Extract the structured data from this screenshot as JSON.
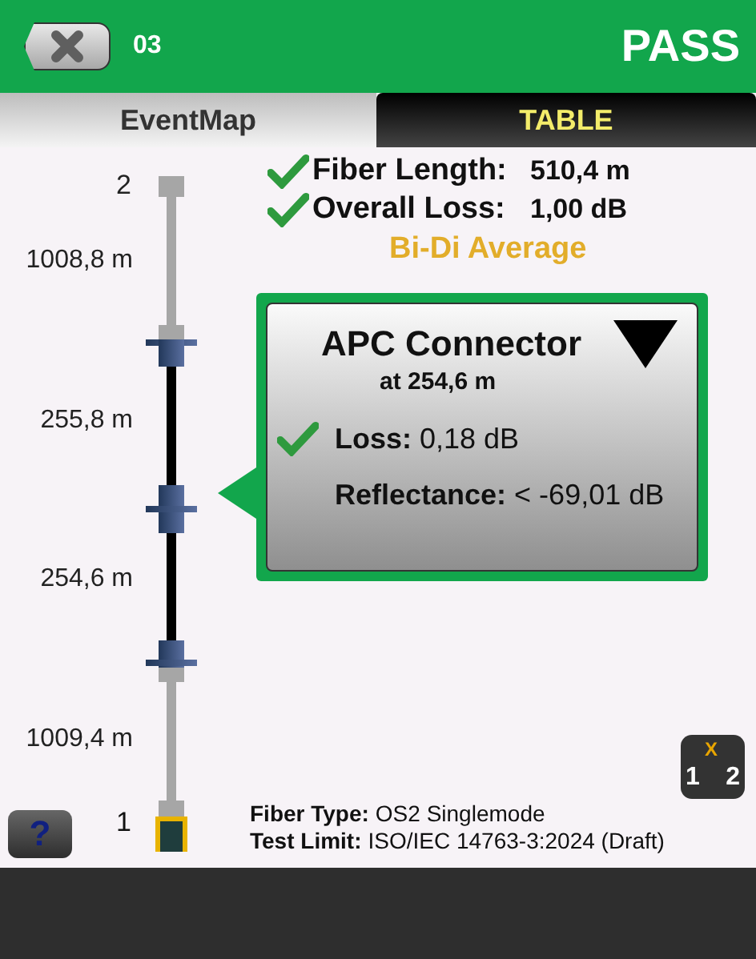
{
  "header": {
    "close_button": true,
    "test_id": "03",
    "result": "PASS",
    "passed": true
  },
  "tabs": [
    {
      "label": "EventMap",
      "selected": true
    },
    {
      "label": "TABLE",
      "selected": false
    }
  ],
  "summary": [
    {
      "label": "Fiber Length:",
      "value": "510,4 m",
      "passed": true
    },
    {
      "label": "Overall Loss:",
      "value": "1,00 dB",
      "passed": true
    }
  ],
  "mode": "Bi-Di Average",
  "map": {
    "far_end": "2",
    "near_end": "1",
    "distances": [
      "1008,8 m",
      "255,8 m",
      "254,6 m",
      "1009,4 m"
    ]
  },
  "event": {
    "title": "APC Connector",
    "position": "at 254,6 m",
    "loss_label": "Loss:",
    "loss_value": "0,18 dB",
    "loss_passed": true,
    "reflectance_label": "Reflectance:",
    "reflectance_value": "< -69,01 dB"
  },
  "fiber_type": {
    "label": "Fiber Type:",
    "value": "OS2 Singlemode"
  },
  "test_limit": {
    "label": "Test Limit:",
    "value": "ISO/IEC 14763-3:2024 (Draft)"
  },
  "help_button": "?",
  "swap_button": {
    "mark": "X",
    "ends": [
      "1",
      "2"
    ]
  }
}
